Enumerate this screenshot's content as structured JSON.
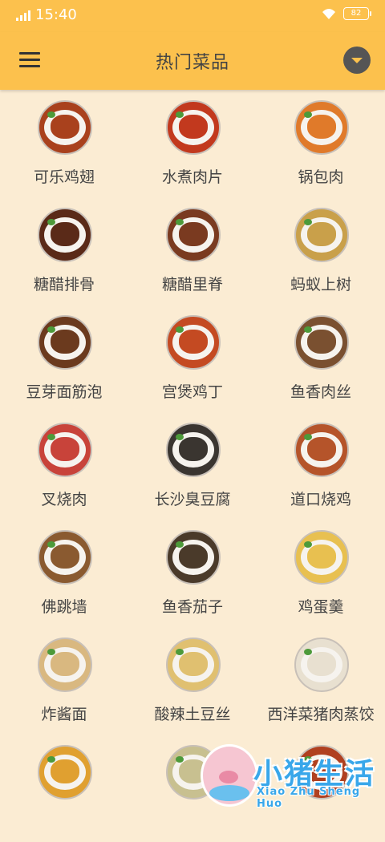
{
  "status_bar": {
    "time": "15:40",
    "battery": "82"
  },
  "app_bar": {
    "title": "热门菜品"
  },
  "dishes": [
    {
      "name": "可乐鸡翅",
      "color": "#a9411d"
    },
    {
      "name": "水煮肉片",
      "color": "#c2391e"
    },
    {
      "name": "锅包肉",
      "color": "#e07a2a"
    },
    {
      "name": "糖醋排骨",
      "color": "#5a2a18"
    },
    {
      "name": "糖醋里脊",
      "color": "#7a3a20"
    },
    {
      "name": "蚂蚁上树",
      "color": "#c9a04a"
    },
    {
      "name": "豆芽面筋泡",
      "color": "#6b3a1e"
    },
    {
      "name": "宫煲鸡丁",
      "color": "#c44a22"
    },
    {
      "name": "鱼香肉丝",
      "color": "#7a5030"
    },
    {
      "name": "叉烧肉",
      "color": "#c8433a"
    },
    {
      "name": "长沙臭豆腐",
      "color": "#3a3530"
    },
    {
      "name": "道口烧鸡",
      "color": "#b5542a"
    },
    {
      "name": "佛跳墙",
      "color": "#8a5a30"
    },
    {
      "name": "鱼香茄子",
      "color": "#4a3a2a"
    },
    {
      "name": "鸡蛋羹",
      "color": "#e8c050"
    },
    {
      "name": "炸酱面",
      "color": "#d9b880"
    },
    {
      "name": "酸辣土豆丝",
      "color": "#e0c070"
    },
    {
      "name": "西洋菜猪肉蒸饺",
      "color": "#e8e0d0"
    },
    {
      "name": "",
      "color": "#e0a030"
    },
    {
      "name": "",
      "color": "#c8c090"
    },
    {
      "name": "",
      "color": "#b04020"
    }
  ],
  "watermark": {
    "title": "小猪生活",
    "subtitle": "Xiao Zhu Sheng Huo"
  }
}
